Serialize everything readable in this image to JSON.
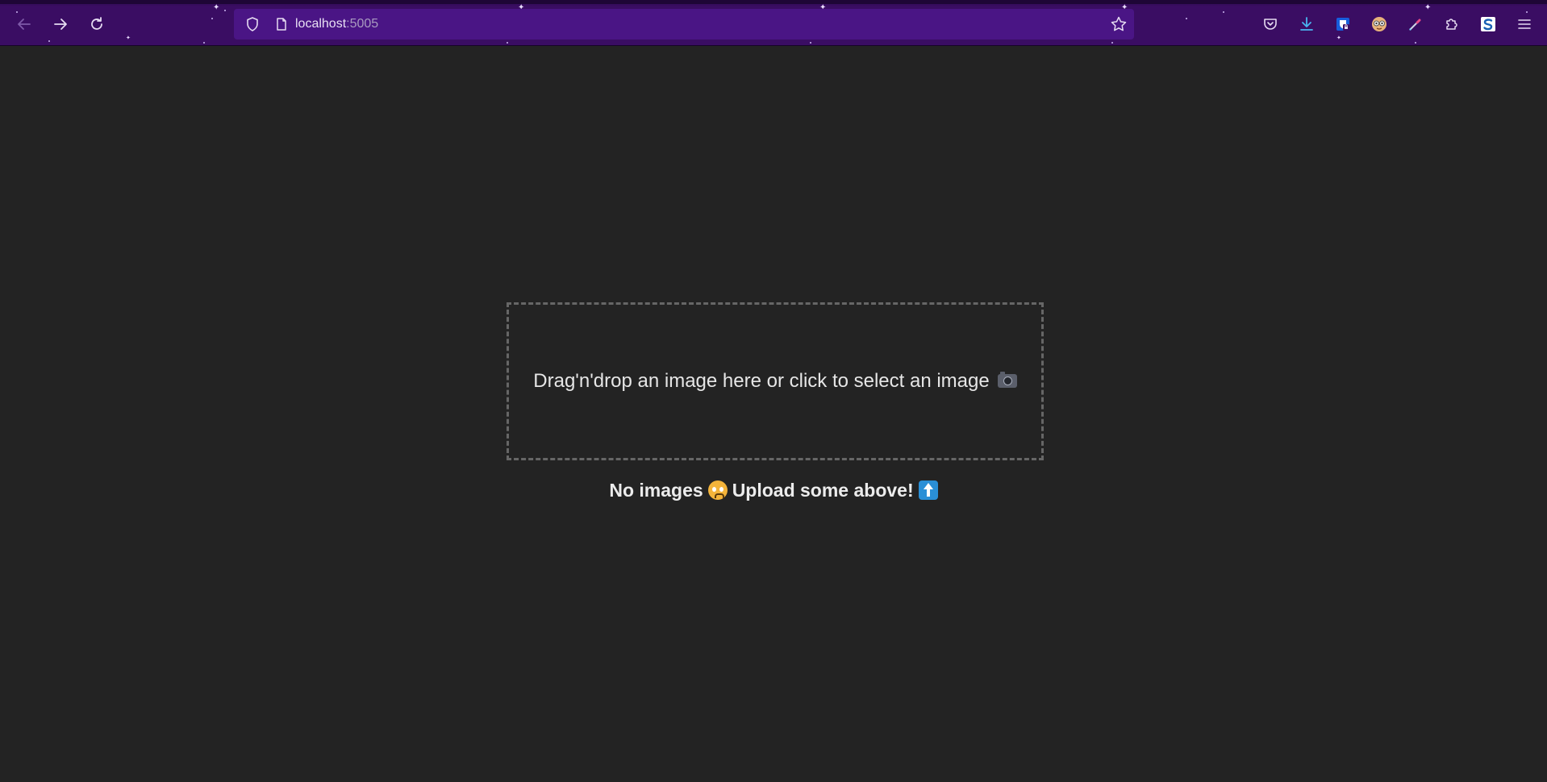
{
  "browser": {
    "url_host": "localhost",
    "url_port": ":5005",
    "icons": {
      "back": "arrow-left-icon",
      "forward": "arrow-right-icon",
      "reload": "reload-icon",
      "shield": "shield-icon",
      "page": "page-icon",
      "bookmark": "star-icon",
      "pocket": "pocket-icon",
      "downloads": "download-icon",
      "extensions": [
        "bitwarden-icon",
        "avatar-extension-icon",
        "dropper-icon",
        "puzzle-icon",
        "s-extension-icon"
      ],
      "menu": "hamburger-menu-icon"
    },
    "colors": {
      "toolbar": "#3a0d63",
      "urlbar": "#4a1585",
      "page_bg": "#232323"
    }
  },
  "page": {
    "dropzone_text": "Drag'n'drop an image here or click to select an image",
    "empty_message_prefix": "No images",
    "empty_message_suffix": "Upload some above!"
  }
}
